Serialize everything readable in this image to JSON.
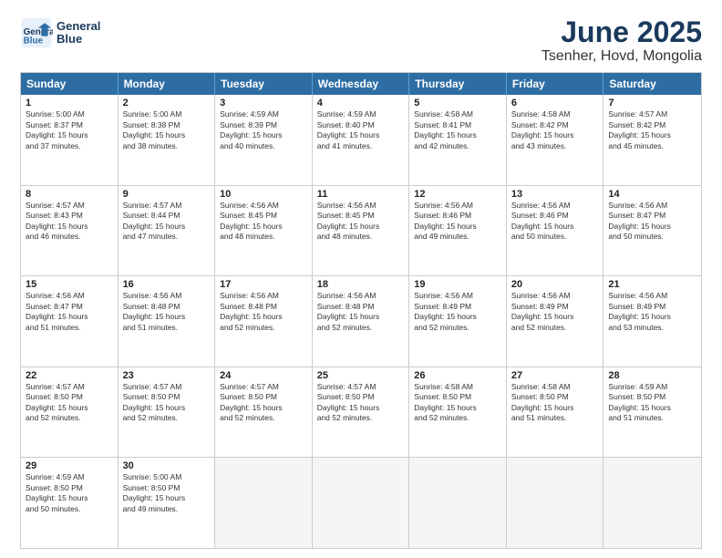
{
  "logo": {
    "line1": "General",
    "line2": "Blue"
  },
  "title": "June 2025",
  "subtitle": "Tsenher, Hovd, Mongolia",
  "headers": [
    "Sunday",
    "Monday",
    "Tuesday",
    "Wednesday",
    "Thursday",
    "Friday",
    "Saturday"
  ],
  "rows": [
    [
      {
        "day": "",
        "info": "",
        "empty": true
      },
      {
        "day": "",
        "info": "",
        "empty": true
      },
      {
        "day": "",
        "info": "",
        "empty": true
      },
      {
        "day": "",
        "info": "",
        "empty": true
      },
      {
        "day": "",
        "info": "",
        "empty": true
      },
      {
        "day": "",
        "info": "",
        "empty": true
      },
      {
        "day": "7",
        "info": "Sunrise: 4:57 AM\nSunset: 8:42 PM\nDaylight: 15 hours\nand 45 minutes."
      }
    ],
    [
      {
        "day": "1",
        "info": "Sunrise: 5:00 AM\nSunset: 8:37 PM\nDaylight: 15 hours\nand 37 minutes."
      },
      {
        "day": "2",
        "info": "Sunrise: 5:00 AM\nSunset: 8:38 PM\nDaylight: 15 hours\nand 38 minutes."
      },
      {
        "day": "3",
        "info": "Sunrise: 4:59 AM\nSunset: 8:39 PM\nDaylight: 15 hours\nand 40 minutes."
      },
      {
        "day": "4",
        "info": "Sunrise: 4:59 AM\nSunset: 8:40 PM\nDaylight: 15 hours\nand 41 minutes."
      },
      {
        "day": "5",
        "info": "Sunrise: 4:58 AM\nSunset: 8:41 PM\nDaylight: 15 hours\nand 42 minutes."
      },
      {
        "day": "6",
        "info": "Sunrise: 4:58 AM\nSunset: 8:42 PM\nDaylight: 15 hours\nand 43 minutes."
      },
      {
        "day": "",
        "info": "",
        "empty": true
      }
    ],
    [
      {
        "day": "8",
        "info": "Sunrise: 4:57 AM\nSunset: 8:43 PM\nDaylight: 15 hours\nand 46 minutes."
      },
      {
        "day": "9",
        "info": "Sunrise: 4:57 AM\nSunset: 8:44 PM\nDaylight: 15 hours\nand 47 minutes."
      },
      {
        "day": "10",
        "info": "Sunrise: 4:56 AM\nSunset: 8:45 PM\nDaylight: 15 hours\nand 48 minutes."
      },
      {
        "day": "11",
        "info": "Sunrise: 4:56 AM\nSunset: 8:45 PM\nDaylight: 15 hours\nand 48 minutes."
      },
      {
        "day": "12",
        "info": "Sunrise: 4:56 AM\nSunset: 8:46 PM\nDaylight: 15 hours\nand 49 minutes."
      },
      {
        "day": "13",
        "info": "Sunrise: 4:56 AM\nSunset: 8:46 PM\nDaylight: 15 hours\nand 50 minutes."
      },
      {
        "day": "14",
        "info": "Sunrise: 4:56 AM\nSunset: 8:47 PM\nDaylight: 15 hours\nand 50 minutes."
      }
    ],
    [
      {
        "day": "15",
        "info": "Sunrise: 4:56 AM\nSunset: 8:47 PM\nDaylight: 15 hours\nand 51 minutes."
      },
      {
        "day": "16",
        "info": "Sunrise: 4:56 AM\nSunset: 8:48 PM\nDaylight: 15 hours\nand 51 minutes."
      },
      {
        "day": "17",
        "info": "Sunrise: 4:56 AM\nSunset: 8:48 PM\nDaylight: 15 hours\nand 52 minutes."
      },
      {
        "day": "18",
        "info": "Sunrise: 4:56 AM\nSunset: 8:48 PM\nDaylight: 15 hours\nand 52 minutes."
      },
      {
        "day": "19",
        "info": "Sunrise: 4:56 AM\nSunset: 8:49 PM\nDaylight: 15 hours\nand 52 minutes."
      },
      {
        "day": "20",
        "info": "Sunrise: 4:56 AM\nSunset: 8:49 PM\nDaylight: 15 hours\nand 52 minutes."
      },
      {
        "day": "21",
        "info": "Sunrise: 4:56 AM\nSunset: 8:49 PM\nDaylight: 15 hours\nand 53 minutes."
      }
    ],
    [
      {
        "day": "22",
        "info": "Sunrise: 4:57 AM\nSunset: 8:50 PM\nDaylight: 15 hours\nand 52 minutes."
      },
      {
        "day": "23",
        "info": "Sunrise: 4:57 AM\nSunset: 8:50 PM\nDaylight: 15 hours\nand 52 minutes."
      },
      {
        "day": "24",
        "info": "Sunrise: 4:57 AM\nSunset: 8:50 PM\nDaylight: 15 hours\nand 52 minutes."
      },
      {
        "day": "25",
        "info": "Sunrise: 4:57 AM\nSunset: 8:50 PM\nDaylight: 15 hours\nand 52 minutes."
      },
      {
        "day": "26",
        "info": "Sunrise: 4:58 AM\nSunset: 8:50 PM\nDaylight: 15 hours\nand 52 minutes."
      },
      {
        "day": "27",
        "info": "Sunrise: 4:58 AM\nSunset: 8:50 PM\nDaylight: 15 hours\nand 51 minutes."
      },
      {
        "day": "28",
        "info": "Sunrise: 4:59 AM\nSunset: 8:50 PM\nDaylight: 15 hours\nand 51 minutes."
      }
    ],
    [
      {
        "day": "29",
        "info": "Sunrise: 4:59 AM\nSunset: 8:50 PM\nDaylight: 15 hours\nand 50 minutes."
      },
      {
        "day": "30",
        "info": "Sunrise: 5:00 AM\nSunset: 8:50 PM\nDaylight: 15 hours\nand 49 minutes."
      },
      {
        "day": "",
        "info": "",
        "empty": true
      },
      {
        "day": "",
        "info": "",
        "empty": true
      },
      {
        "day": "",
        "info": "",
        "empty": true
      },
      {
        "day": "",
        "info": "",
        "empty": true
      },
      {
        "day": "",
        "info": "",
        "empty": true
      }
    ]
  ],
  "colors": {
    "header_bg": "#2e6da4",
    "header_text": "#ffffff",
    "accent": "#1a3a5c"
  }
}
